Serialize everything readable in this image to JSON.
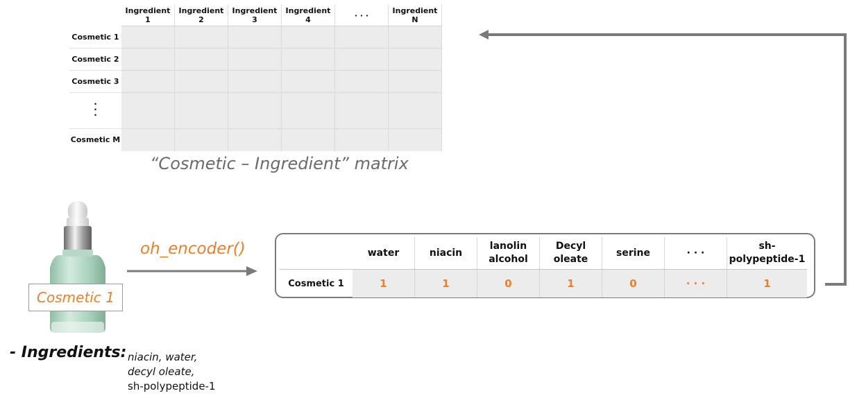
{
  "matrix": {
    "columns": [
      "Ingredient 1",
      "Ingredient 2",
      "Ingredient 3",
      "Ingredient 4",
      "· · ·",
      "Ingredient N"
    ],
    "rows": [
      "Cosmetic 1",
      "Cosmetic 2",
      "Cosmetic 3",
      "·\n·\n·",
      "Cosmetic M"
    ],
    "caption": "“Cosmetic – Ingredient” matrix"
  },
  "product": {
    "label": "Cosmetic 1"
  },
  "encoder": {
    "label": "oh_encoder()"
  },
  "vector": {
    "columns": [
      "water",
      "niacin",
      "lanolin alcohol",
      "Decyl oleate",
      "serine",
      "· · ·",
      "sh-polypeptide-1"
    ],
    "row_label": "Cosmetic 1",
    "values": [
      "1",
      "1",
      "0",
      "1",
      "0",
      "· · ·",
      "1"
    ]
  },
  "ingredients": {
    "heading": "- Ingredients:",
    "lines": [
      "niacin, water,",
      "decyl oleate,",
      "sh-polypeptide-1"
    ]
  },
  "colors": {
    "accent": "#e8802c",
    "cell_fill": "#ececec",
    "arrow": "#7a7a7a",
    "caption": "#6a6a6a"
  }
}
